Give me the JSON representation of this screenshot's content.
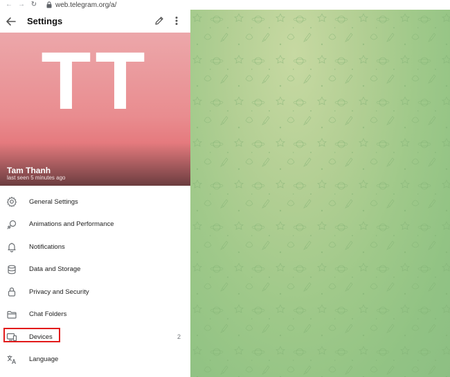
{
  "browser": {
    "url": "web.telegram.org/a/"
  },
  "header": {
    "title": "Settings"
  },
  "profile": {
    "initials": "TT",
    "name": "Tam Thanh",
    "status": "last seen 5 minutes ago",
    "background_color": "#e98c8f"
  },
  "menu": {
    "items": [
      {
        "label": "General Settings",
        "icon": "gear-icon"
      },
      {
        "label": "Animations and Performance",
        "icon": "animation-icon"
      },
      {
        "label": "Notifications",
        "icon": "bell-icon"
      },
      {
        "label": "Data and Storage",
        "icon": "database-icon"
      },
      {
        "label": "Privacy and Security",
        "icon": "lock-icon"
      },
      {
        "label": "Chat Folders",
        "icon": "folder-icon"
      },
      {
        "label": "Devices",
        "icon": "devices-icon",
        "count": "2"
      },
      {
        "label": "Language",
        "icon": "language-icon"
      }
    ]
  },
  "colors": {
    "highlight_border": "#e21a1a",
    "chat_background": "#a0c98a"
  }
}
